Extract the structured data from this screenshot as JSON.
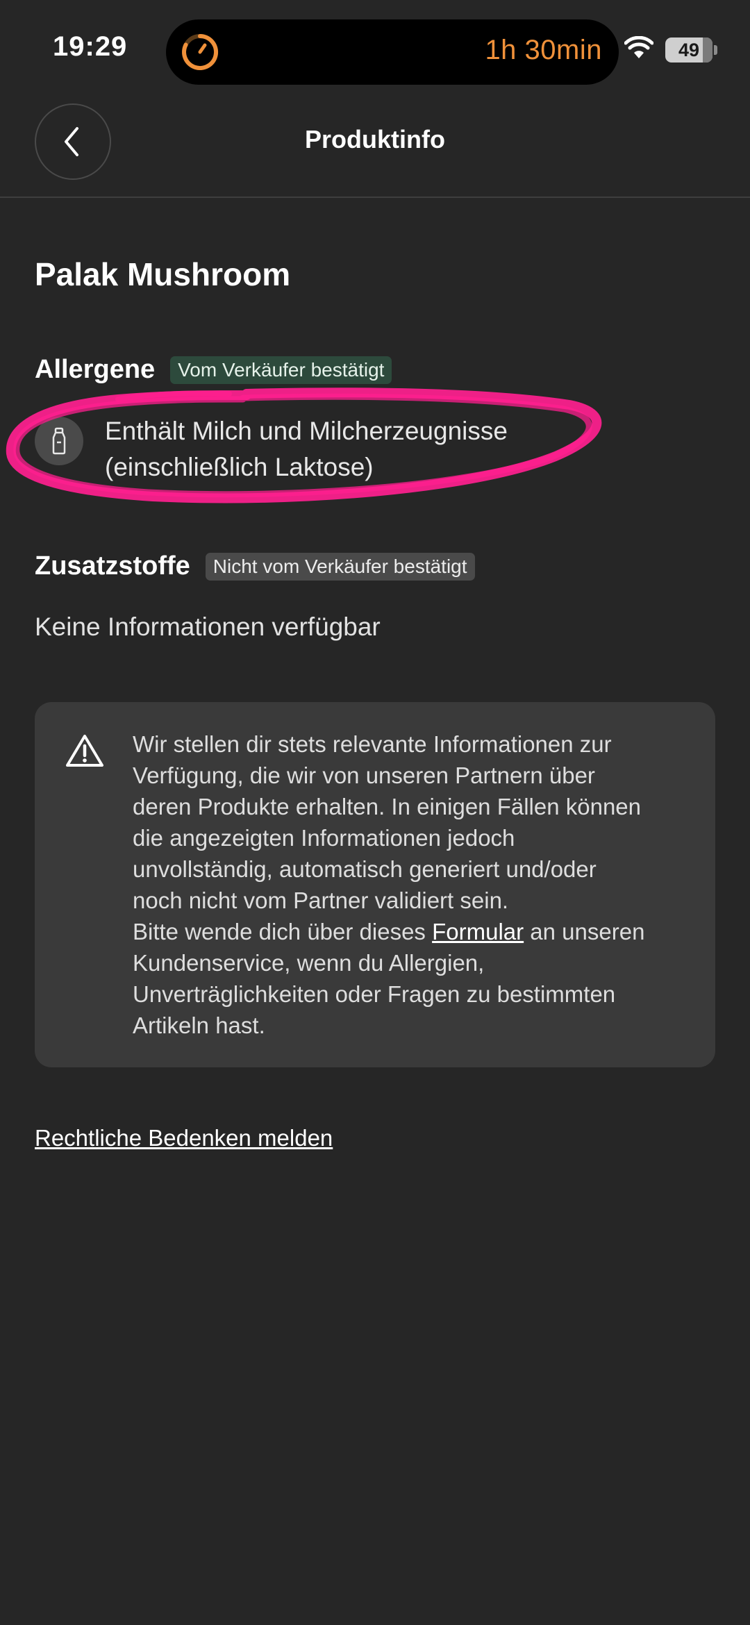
{
  "status_bar": {
    "time": "19:29",
    "timer": "1h 30min",
    "battery": "49",
    "timer_color": "#f0913a"
  },
  "header": {
    "title": "Produktinfo",
    "back_icon": "chevron-left-icon"
  },
  "product": {
    "name": "Palak Mushroom"
  },
  "allergens": {
    "title": "Allergene",
    "badge": "Vom Verkäufer bestätigt",
    "items": [
      {
        "icon": "milk-bottle-icon",
        "line1": "Enthält Milch und Milcherzeugnisse",
        "line2": "(einschließlich Laktose)"
      }
    ]
  },
  "additives": {
    "title": "Zusatzstoffe",
    "badge": "Nicht vom Verkäufer bestätigt",
    "empty_text": "Keine Informationen verfügbar"
  },
  "notice": {
    "icon": "warning-triangle-icon",
    "line1": "Wir stellen dir stets relevante Informationen zur",
    "line2": "Verfügung, die wir von unseren Partnern über",
    "line3": "deren Produkte erhalten. In einigen Fällen können",
    "line4": "die angezeigten Informationen jedoch",
    "line5": "unvollständig, automatisch generiert und/oder",
    "line6": "noch nicht vom Partner validiert sein.",
    "line7_pre": "Bitte wende dich über dieses ",
    "link": "Formular",
    "line7_post": " an unseren",
    "line8": "Kundenservice, wenn du Allergien,",
    "line9": "Unverträglichkeiten oder Fragen zu bestimmten",
    "line10": "Artikeln hast."
  },
  "footer": {
    "legal_link": "Rechtliche Bedenken melden"
  },
  "colors": {
    "background": "#262626",
    "card": "#3a3a3a",
    "badge_confirmed": "#2d4a3c",
    "badge_unconfirmed": "#4a4a4a",
    "highlight": "#ff1f8f"
  }
}
